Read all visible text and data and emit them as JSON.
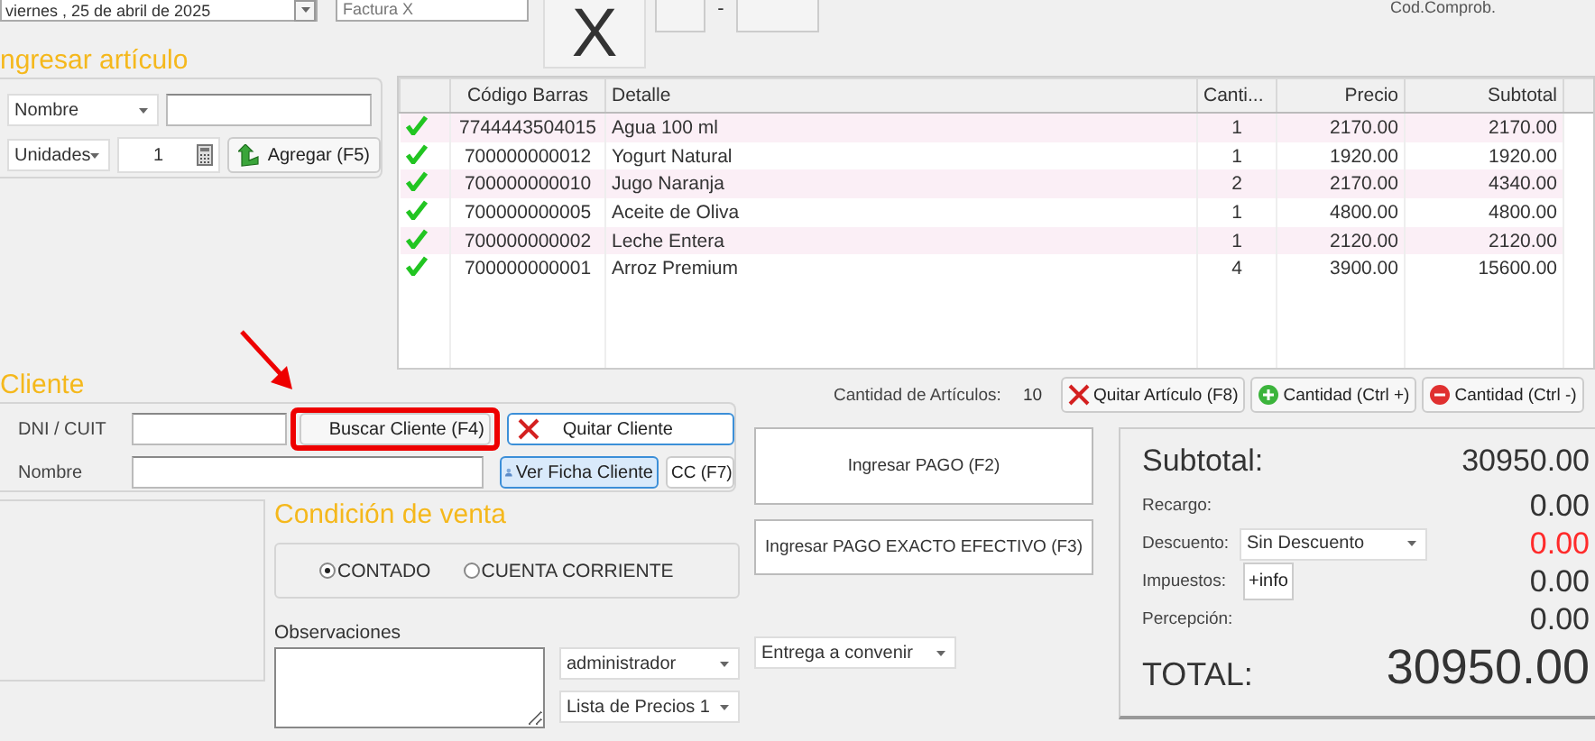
{
  "header": {
    "date": "viernes , 25 de    abril    de 2025",
    "invoice_type": "Factura X",
    "letter": "X",
    "separator": "-",
    "code_label": "Cod.Comprob."
  },
  "add_item": {
    "title": "ngresar artículo",
    "search_by": "Nombre",
    "unit": "Unidades",
    "quantity": "1",
    "add_button": "Agregar (F5)"
  },
  "table": {
    "columns": [
      "Código Barras",
      "Detalle",
      "Canti...",
      "Precio",
      "Subtotal"
    ],
    "rows": [
      {
        "checked": true,
        "cells": [
          "7744443504015",
          "Agua 100 ml",
          "1",
          "2170.00",
          "2170.00"
        ]
      },
      {
        "checked": true,
        "cells": [
          "700000000012",
          "Yogurt Natural",
          "1",
          "1920.00",
          "1920.00"
        ]
      },
      {
        "checked": true,
        "cells": [
          "700000000010",
          "Jugo Naranja",
          "2",
          "2170.00",
          "4340.00"
        ]
      },
      {
        "checked": true,
        "cells": [
          "700000000005",
          "Aceite de Oliva",
          "1",
          "4800.00",
          "4800.00"
        ]
      },
      {
        "checked": true,
        "cells": [
          "700000000002",
          "Leche Entera",
          "1",
          "2120.00",
          "2120.00"
        ]
      },
      {
        "checked": true,
        "cells": [
          "700000000001",
          "Arroz Premium",
          "4",
          "3900.00",
          "15600.00"
        ]
      }
    ]
  },
  "client": {
    "title": "Cliente",
    "id_label": "DNI / CUIT",
    "name_label": "Nombre",
    "search_button": "Buscar Cliente (F4)",
    "remove_button": "Quitar Cliente",
    "view_button": "Ver Ficha Cliente",
    "account_button": "CC (F7)"
  },
  "sale_condition": {
    "title": "Condición de venta",
    "options": [
      {
        "label": "CONTADO",
        "selected": true
      },
      {
        "label": "CUENTA CORRIENTE",
        "selected": false
      }
    ]
  },
  "notes": {
    "label": "Observaciones",
    "user": "administrador",
    "price_list": "Lista de Precios 1",
    "delivery": "Entrega a convenir"
  },
  "items_count": {
    "label": "Cantidad de Artículos:",
    "value": "10"
  },
  "item_buttons": [
    {
      "kind": "remove",
      "label": "Quitar Artículo (F8)"
    },
    {
      "kind": "plus",
      "label": "Cantidad (Ctrl +)"
    },
    {
      "kind": "minus",
      "label": "Cantidad (Ctrl -)"
    }
  ],
  "payment_buttons": [
    "Ingresar PAGO (F2)",
    "Ingresar PAGO EXACTO EFECTIVO (F3)"
  ],
  "totals": {
    "subtotal_label": "Subtotal:",
    "subtotal": "30950.00",
    "lines": [
      {
        "kind": "plain",
        "label": "Recargo:",
        "value": "0.00",
        "color": "#333333"
      },
      {
        "kind": "select",
        "label": "Descuento:",
        "control": "Sin Descuento",
        "value": "0.00",
        "color": "#ff2b2b"
      },
      {
        "kind": "button",
        "label": "Impuestos:",
        "control": "+info",
        "value": "0.00",
        "color": "#333333"
      },
      {
        "kind": "plain",
        "label": "Percepción:",
        "value": "0.00",
        "color": "#333333"
      }
    ],
    "total_label": "TOTAL:",
    "total": "30950.00"
  }
}
